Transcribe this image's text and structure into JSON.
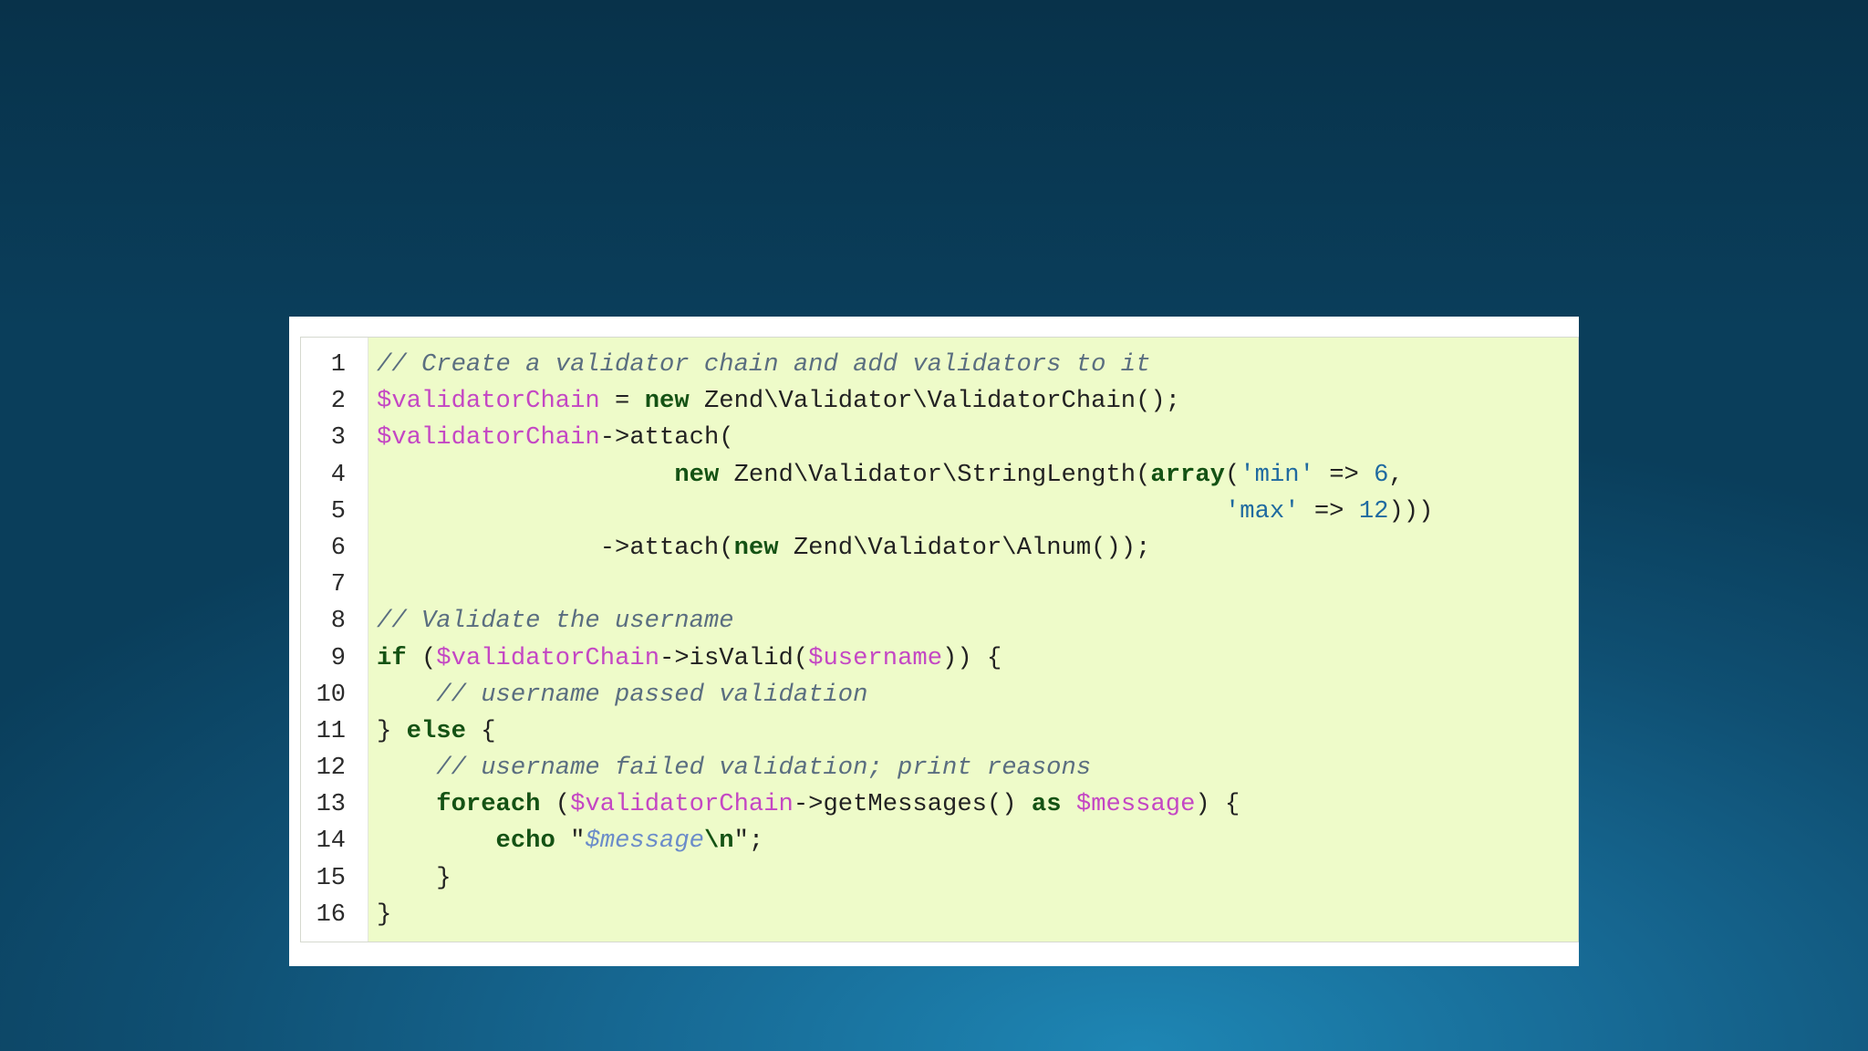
{
  "colors": {
    "background_top": "#0a3e5b",
    "background_glow": "#1e86b4",
    "code_background": "#eefbc9",
    "comment": "#5a6e80",
    "variable": "#c447c4",
    "keyword": "#145214",
    "string": "#1f6aa0"
  },
  "code": {
    "language": "PHP",
    "line_numbers": [
      "1",
      "2",
      "3",
      "4",
      "5",
      "6",
      "7",
      "8",
      "9",
      "10",
      "11",
      "12",
      "13",
      "14",
      "15",
      "16"
    ],
    "lines": [
      [
        {
          "type": "comment",
          "text": "// Create a validator chain and add validators to it"
        }
      ],
      [
        {
          "type": "var",
          "text": "$validatorChain"
        },
        {
          "type": "plain",
          "text": " = "
        },
        {
          "type": "kw",
          "text": "new"
        },
        {
          "type": "plain",
          "text": " Zend\\Validator\\ValidatorChain();"
        }
      ],
      [
        {
          "type": "var",
          "text": "$validatorChain"
        },
        {
          "type": "plain",
          "text": "->attach("
        }
      ],
      [
        {
          "type": "plain",
          "text": "                    "
        },
        {
          "type": "kw",
          "text": "new"
        },
        {
          "type": "plain",
          "text": " Zend\\Validator\\StringLength("
        },
        {
          "type": "kw",
          "text": "array"
        },
        {
          "type": "plain",
          "text": "("
        },
        {
          "type": "str",
          "text": "'min'"
        },
        {
          "type": "plain",
          "text": " => "
        },
        {
          "type": "num",
          "text": "6"
        },
        {
          "type": "plain",
          "text": ","
        }
      ],
      [
        {
          "type": "plain",
          "text": "                                                         "
        },
        {
          "type": "str",
          "text": "'max'"
        },
        {
          "type": "plain",
          "text": " => "
        },
        {
          "type": "num",
          "text": "12"
        },
        {
          "type": "plain",
          "text": ")))"
        }
      ],
      [
        {
          "type": "plain",
          "text": "               ->attach("
        },
        {
          "type": "kw",
          "text": "new"
        },
        {
          "type": "plain",
          "text": " Zend\\Validator\\Alnum());"
        }
      ],
      [
        {
          "type": "plain",
          "text": ""
        }
      ],
      [
        {
          "type": "comment",
          "text": "// Validate the username"
        }
      ],
      [
        {
          "type": "kw",
          "text": "if"
        },
        {
          "type": "plain",
          "text": " ("
        },
        {
          "type": "var",
          "text": "$validatorChain"
        },
        {
          "type": "plain",
          "text": "->isValid("
        },
        {
          "type": "var",
          "text": "$username"
        },
        {
          "type": "plain",
          "text": ")) {"
        }
      ],
      [
        {
          "type": "plain",
          "text": "    "
        },
        {
          "type": "comment",
          "text": "// username passed validation"
        }
      ],
      [
        {
          "type": "plain",
          "text": "} "
        },
        {
          "type": "kw",
          "text": "else"
        },
        {
          "type": "plain",
          "text": " {"
        }
      ],
      [
        {
          "type": "plain",
          "text": "    "
        },
        {
          "type": "comment",
          "text": "// username failed validation; print reasons"
        }
      ],
      [
        {
          "type": "plain",
          "text": "    "
        },
        {
          "type": "kw",
          "text": "foreach"
        },
        {
          "type": "plain",
          "text": " ("
        },
        {
          "type": "var",
          "text": "$validatorChain"
        },
        {
          "type": "plain",
          "text": "->getMessages() "
        },
        {
          "type": "kw",
          "text": "as"
        },
        {
          "type": "plain",
          "text": " "
        },
        {
          "type": "var",
          "text": "$message"
        },
        {
          "type": "plain",
          "text": ") {"
        }
      ],
      [
        {
          "type": "plain",
          "text": "        "
        },
        {
          "type": "kw",
          "text": "echo"
        },
        {
          "type": "plain",
          "text": " \""
        },
        {
          "type": "strvar",
          "text": "$message"
        },
        {
          "type": "kw",
          "text": "\\n"
        },
        {
          "type": "plain",
          "text": "\";"
        }
      ],
      [
        {
          "type": "plain",
          "text": "    }"
        }
      ],
      [
        {
          "type": "plain",
          "text": "}"
        }
      ]
    ]
  }
}
